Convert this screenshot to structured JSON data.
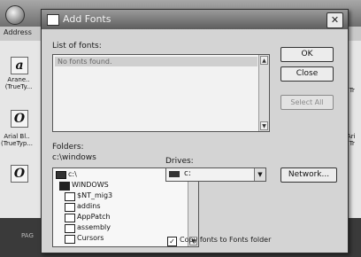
{
  "background": {
    "address_label": "Address",
    "font_files": [
      {
        "glyph": "a",
        "label": "Arane..\n(TrueTy..."
      },
      {
        "glyph": "O",
        "label": "Arial Bl..\n(TrueTyp..."
      },
      {
        "glyph": "O",
        "label": ""
      }
    ],
    "right_labels": [
      "(Tr",
      "Ari\n(Tr"
    ],
    "taskbar_text": "PAG"
  },
  "dialog": {
    "title": "Add Fonts",
    "close_glyph": "✕",
    "list_label": "List of fonts:",
    "list_items": [
      "No fonts found."
    ],
    "ok_label": "OK",
    "close_label": "Close",
    "select_all_label": "Select All",
    "folders_label": "Folders:",
    "folder_path": "c:\\windows",
    "folders": [
      {
        "name": "c:\\",
        "icon": "drive-icon"
      },
      {
        "name": "WINDOWS",
        "icon": "open-folder-icon"
      },
      {
        "name": "$NT_mig3",
        "icon": "folder-icon"
      },
      {
        "name": "addins",
        "icon": "folder-icon"
      },
      {
        "name": "AppPatch",
        "icon": "folder-icon"
      },
      {
        "name": "assembly",
        "icon": "folder-icon"
      },
      {
        "name": "Cursors",
        "icon": "folder-icon"
      }
    ],
    "drives_label": "Drives:",
    "drive_value": "c:",
    "network_label": "Network...",
    "copy_label": "Copy fonts to Fonts folder",
    "copy_checked": "✓"
  }
}
